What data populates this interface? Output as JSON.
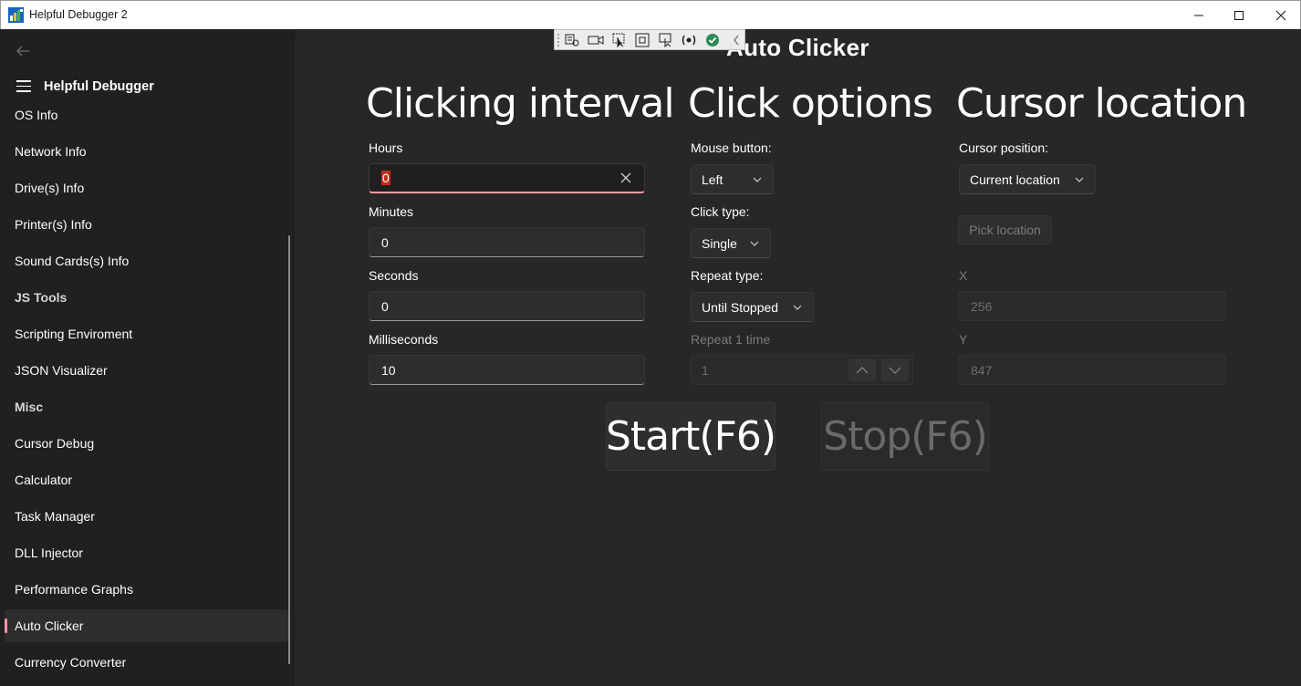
{
  "window": {
    "title": "Helpful Debugger 2"
  },
  "sidebar": {
    "title": "Helpful Debugger",
    "items": [
      {
        "label": "OS Info",
        "header": false
      },
      {
        "label": "Network Info",
        "header": false
      },
      {
        "label": "Drive(s) Info",
        "header": false
      },
      {
        "label": "Printer(s) Info",
        "header": false
      },
      {
        "label": "Sound Cards(s) Info",
        "header": false
      },
      {
        "label": "JS Tools",
        "header": true
      },
      {
        "label": "Scripting Enviroment",
        "header": false
      },
      {
        "label": "JSON Visualizer",
        "header": false
      },
      {
        "label": "Misc",
        "header": true
      },
      {
        "label": "Cursor Debug",
        "header": false
      },
      {
        "label": "Calculator",
        "header": false
      },
      {
        "label": "Task Manager",
        "header": false
      },
      {
        "label": "DLL Injector",
        "header": false
      },
      {
        "label": "Performance Graphs",
        "header": false
      },
      {
        "label": "Auto Clicker",
        "header": false,
        "selected": true
      },
      {
        "label": "Currency Converter",
        "header": false
      }
    ]
  },
  "page": {
    "title": "Auto Clicker"
  },
  "interval": {
    "title": "Clicking interval",
    "hours_label": "Hours",
    "hours_value": "0",
    "minutes_label": "Minutes",
    "minutes_value": "0",
    "seconds_label": "Seconds",
    "seconds_value": "0",
    "ms_label": "Milliseconds",
    "ms_value": "10"
  },
  "click_options": {
    "title": "Click options",
    "mouse_button_label": "Mouse button:",
    "mouse_button_value": "Left",
    "click_type_label": "Click type:",
    "click_type_value": "Single",
    "repeat_type_label": "Repeat type:",
    "repeat_type_value": "Until Stopped",
    "repeat_count_label": "Repeat 1 time",
    "repeat_count_value": "1"
  },
  "cursor_location": {
    "title": "Cursor location",
    "position_label": "Cursor position:",
    "position_value": "Current location",
    "pick_button": "Pick location",
    "x_label": "X",
    "x_value": "256",
    "y_label": "Y",
    "y_value": "847"
  },
  "actions": {
    "start": "Start(F6)",
    "stop": "Stop(F6)"
  },
  "colors": {
    "accent": "#ff99a4",
    "background": "#202020",
    "panel": "#272727"
  }
}
